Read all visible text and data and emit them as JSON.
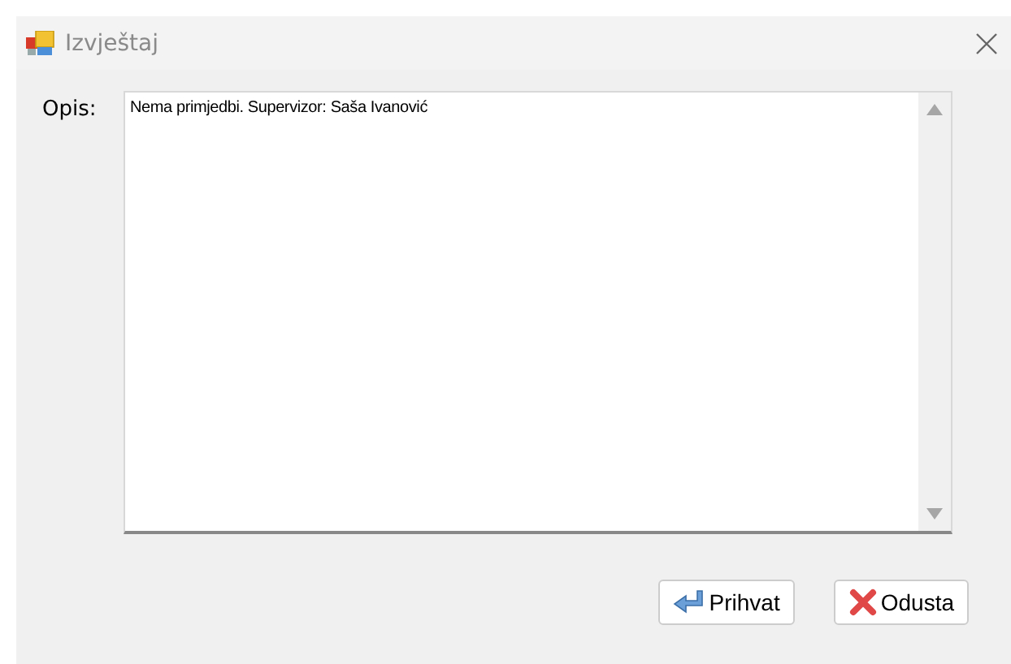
{
  "window": {
    "title": "Izvještaj"
  },
  "form": {
    "label": "Opis:",
    "value": "Nema primjedbi. Supervizor: Saša Ivanović"
  },
  "buttons": [
    {
      "kind": "accept",
      "label": "Prihvat"
    },
    {
      "kind": "cancel",
      "label": "Odusta"
    }
  ]
}
